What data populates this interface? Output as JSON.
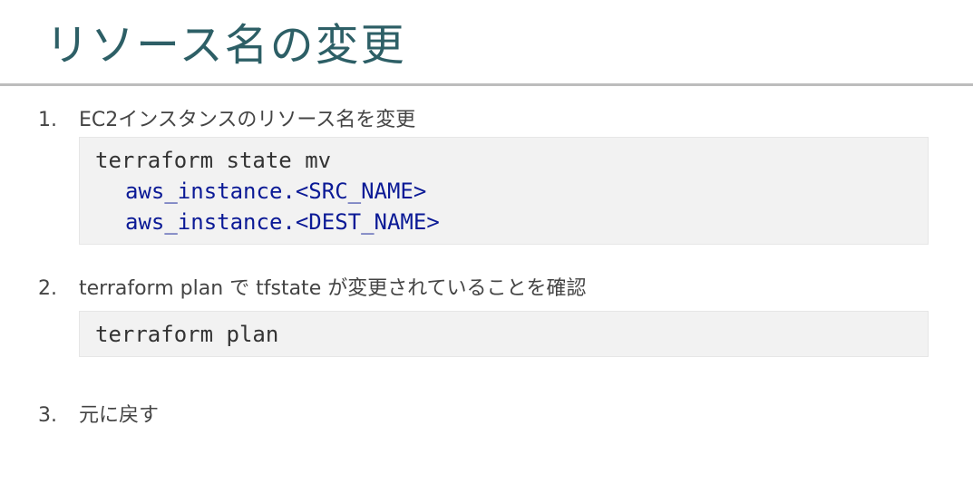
{
  "title": "リソース名の変更",
  "steps": [
    {
      "number": "1.",
      "text": "EC2インスタンスのリソース名を変更",
      "code": [
        "terraform state mv",
        "aws_instance.<SRC_NAME>",
        "aws_instance.<DEST_NAME>"
      ]
    },
    {
      "number": "2.",
      "text": "terraform plan で tfstate が変更されていることを確認",
      "code": [
        "terraform plan"
      ]
    },
    {
      "number": "3.",
      "text": "元に戻す"
    }
  ],
  "colors": {
    "title": "#2d5f66",
    "code_arg": "#0b1a96",
    "code_bg": "#f2f2f2"
  }
}
